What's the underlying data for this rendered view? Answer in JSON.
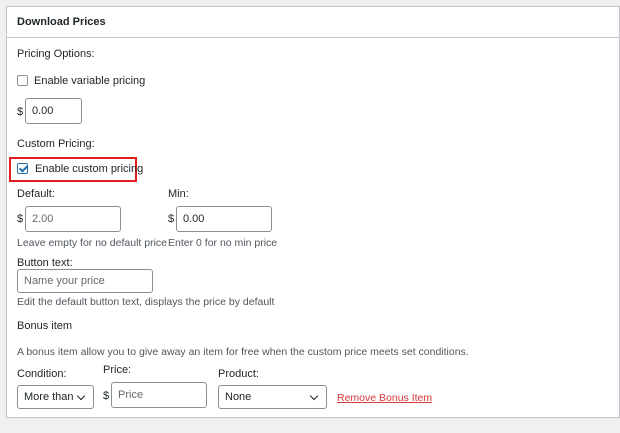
{
  "panel": {
    "title": "Download Prices"
  },
  "pricing_options": {
    "heading": "Pricing Options:",
    "variable_pricing_label": "Enable variable pricing",
    "variable_pricing_checked": false,
    "currency_symbol": "$",
    "price_value": "0.00"
  },
  "custom_pricing": {
    "heading": "Custom Pricing:",
    "enable_label": "Enable custom pricing",
    "enable_checked": true,
    "default_label": "Default:",
    "default_currency": "$",
    "default_placeholder": "2.00",
    "default_help": "Leave empty for no default price",
    "min_label": "Min:",
    "min_currency": "$",
    "min_value": "0.00",
    "min_help": "Enter 0 for no min price",
    "button_text_label": "Button text:",
    "button_text_placeholder": "Name your price",
    "button_text_help": "Edit the default button text, displays the price by default"
  },
  "bonus_item": {
    "heading": "Bonus item",
    "description": "A bonus item allow you to give away an item for free when the custom price meets set conditions.",
    "condition_label": "Condition:",
    "condition_value": "More than",
    "price_label": "Price:",
    "price_currency": "$",
    "price_placeholder": "Price",
    "product_label": "Product:",
    "product_value": "None",
    "remove_link": "Remove Bonus Item"
  },
  "colors": {
    "highlight_border": "#e01e1e",
    "link": "#d63638",
    "checkbox_accent": "#2271b1"
  }
}
